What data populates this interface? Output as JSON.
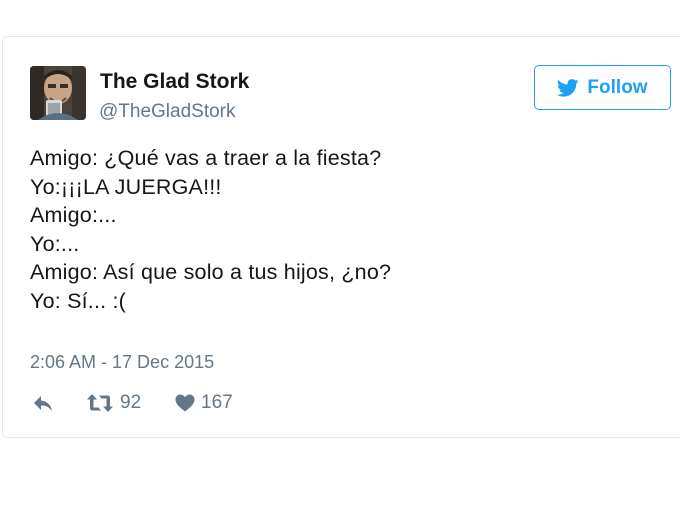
{
  "tweet": {
    "author_name": "The Glad Stork",
    "author_handle": "@TheGladStork",
    "follow_label": "Follow",
    "lines": [
      "Amigo: ¿Qué vas a traer a la fiesta?",
      "Yo:¡¡¡LA JUERGA!!!",
      "Amigo:...",
      "Yo:...",
      "Amigo: Así que solo a tus hijos, ¿no?",
      "Yo: Sí... :("
    ],
    "timestamp": "2:06 AM - 17 Dec 2015",
    "retweet_count": "92",
    "like_count": "167"
  },
  "icons": {
    "follow": "twitter-bird-icon",
    "reply": "reply-icon",
    "retweet": "retweet-icon",
    "like": "heart-icon"
  },
  "colors": {
    "accent": "#1da1f2",
    "muted": "#657786",
    "text": "#14171a",
    "border": "#e1e8ed"
  }
}
